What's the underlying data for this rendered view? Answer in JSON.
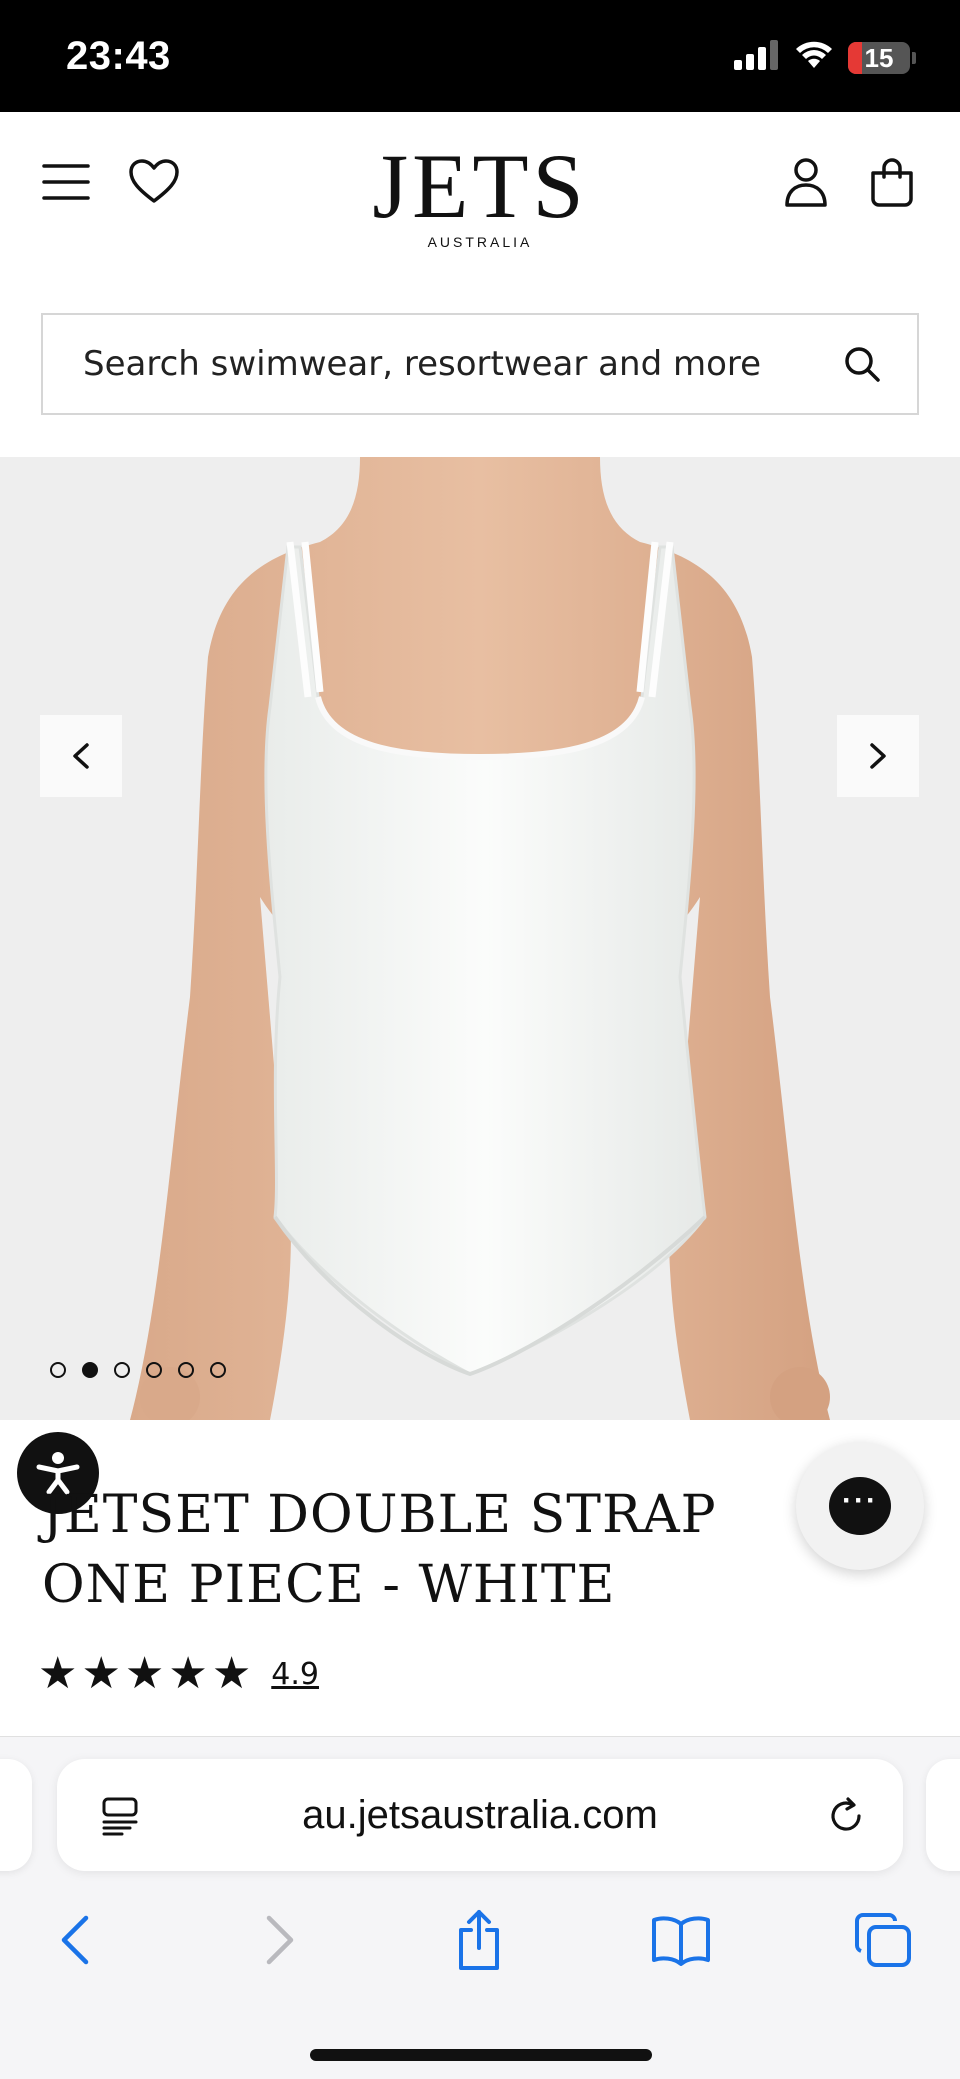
{
  "status_bar": {
    "time": "23:43",
    "battery_level": "15",
    "icons": [
      "signal-icon",
      "wifi-icon",
      "battery-icon"
    ]
  },
  "header": {
    "logo_main": "JETS",
    "logo_sub": "AUSTRALIA",
    "icons": [
      "menu-icon",
      "heart-icon",
      "account-icon",
      "bag-icon"
    ]
  },
  "search": {
    "placeholder": "Search swimwear, resortwear and more"
  },
  "gallery": {
    "image_description_icon": "product-photo",
    "total_images": 6,
    "active_index": 1
  },
  "product": {
    "title_line1": "JETSET DOUBLE STRAP",
    "title_line2": "ONE PIECE - WHITE",
    "rating_value": "4.9",
    "stars": 5
  },
  "browser": {
    "url": "au.jetsaustralia.com",
    "icons": [
      "reader-icon",
      "reload-icon",
      "back-icon",
      "forward-icon",
      "share-icon",
      "bookmarks-icon",
      "tabs-icon"
    ]
  },
  "colors": {
    "accent_blue": "#1a73e8",
    "disabled_gray": "#b9b9be",
    "battery_red": "#e53935"
  }
}
